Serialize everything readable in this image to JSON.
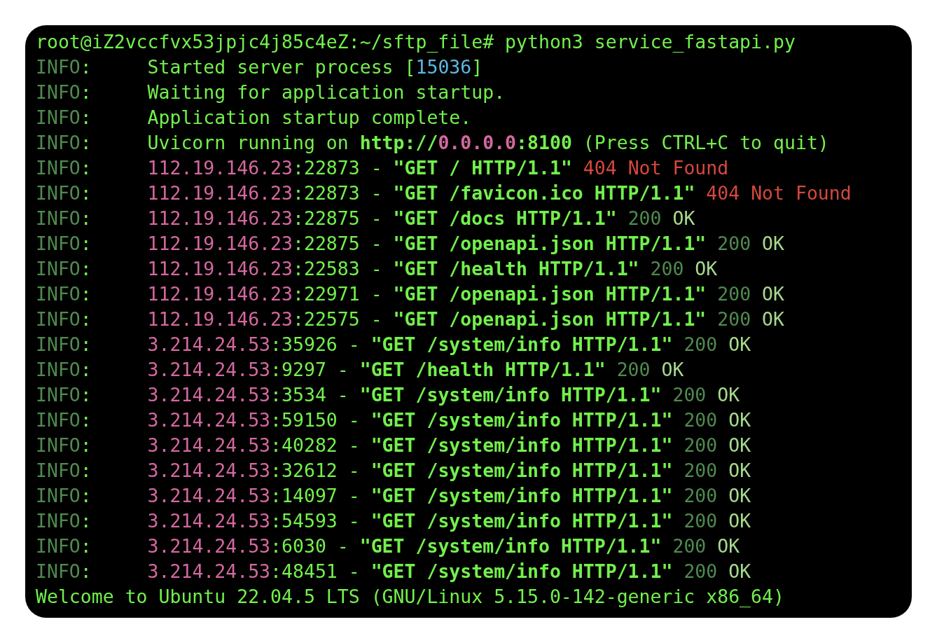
{
  "terminal": {
    "lines": [
      [
        {
          "text": "root@iZ2vccfvx53jpjc4j85c4eZ:~/sftp_file# python3 service_fastapi.py",
          "kind": "plain"
        }
      ],
      [
        {
          "text": "INFO",
          "kind": "dim"
        },
        {
          "text": ":     Started server process [",
          "kind": "plain"
        },
        {
          "text": "15036",
          "kind": "pid"
        },
        {
          "text": "]",
          "kind": "plain"
        }
      ],
      [
        {
          "text": "INFO",
          "kind": "dim"
        },
        {
          "text": ":     Waiting for application startup.",
          "kind": "plain"
        }
      ],
      [
        {
          "text": "INFO",
          "kind": "dim"
        },
        {
          "text": ":     Application startup complete.",
          "kind": "plain"
        }
      ],
      [
        {
          "text": "INFO",
          "kind": "dim"
        },
        {
          "text": ":     Uvicorn running on ",
          "kind": "plain"
        },
        {
          "text": "http://",
          "kind": "bold"
        },
        {
          "text": "0.0.0.0",
          "kind": "host-bold"
        },
        {
          "text": ":8100",
          "kind": "bold"
        },
        {
          "text": " (Press CTRL+C to quit)",
          "kind": "plain"
        }
      ],
      [
        {
          "text": "INFO",
          "kind": "dim"
        },
        {
          "text": ":     ",
          "kind": "plain"
        },
        {
          "text": "112.19.146.23",
          "kind": "host"
        },
        {
          "text": ":22873 - ",
          "kind": "plain"
        },
        {
          "text": "\"GET / HTTP/1.1\"",
          "kind": "bold"
        },
        {
          "text": " 404 Not Found",
          "kind": "error"
        }
      ],
      [
        {
          "text": "INFO",
          "kind": "dim"
        },
        {
          "text": ":     ",
          "kind": "plain"
        },
        {
          "text": "112.19.146.23",
          "kind": "host"
        },
        {
          "text": ":22873 - ",
          "kind": "plain"
        },
        {
          "text": "\"GET /favicon.ico HTTP/1.1\"",
          "kind": "bold"
        },
        {
          "text": " 404 Not Found",
          "kind": "error"
        }
      ],
      [
        {
          "text": "INFO",
          "kind": "dim"
        },
        {
          "text": ":     ",
          "kind": "plain"
        },
        {
          "text": "112.19.146.23",
          "kind": "host"
        },
        {
          "text": ":22875 - ",
          "kind": "plain"
        },
        {
          "text": "\"GET /docs HTTP/1.1\"",
          "kind": "bold"
        },
        {
          "text": " 200",
          "kind": "code"
        },
        {
          "text": " OK",
          "kind": "ok"
        }
      ],
      [
        {
          "text": "INFO",
          "kind": "dim"
        },
        {
          "text": ":     ",
          "kind": "plain"
        },
        {
          "text": "112.19.146.23",
          "kind": "host"
        },
        {
          "text": ":22875 - ",
          "kind": "plain"
        },
        {
          "text": "\"GET /openapi.json HTTP/1.1\"",
          "kind": "bold"
        },
        {
          "text": " 200",
          "kind": "code"
        },
        {
          "text": " OK",
          "kind": "ok"
        }
      ],
      [
        {
          "text": "INFO",
          "kind": "dim"
        },
        {
          "text": ":     ",
          "kind": "plain"
        },
        {
          "text": "112.19.146.23",
          "kind": "host"
        },
        {
          "text": ":22583 - ",
          "kind": "plain"
        },
        {
          "text": "\"GET /health HTTP/1.1\"",
          "kind": "bold"
        },
        {
          "text": " 200",
          "kind": "code"
        },
        {
          "text": " OK",
          "kind": "ok"
        }
      ],
      [
        {
          "text": "INFO",
          "kind": "dim"
        },
        {
          "text": ":     ",
          "kind": "plain"
        },
        {
          "text": "112.19.146.23",
          "kind": "host"
        },
        {
          "text": ":22971 - ",
          "kind": "plain"
        },
        {
          "text": "\"GET /openapi.json HTTP/1.1\"",
          "kind": "bold"
        },
        {
          "text": " 200",
          "kind": "code"
        },
        {
          "text": " OK",
          "kind": "ok"
        }
      ],
      [
        {
          "text": "INFO",
          "kind": "dim"
        },
        {
          "text": ":     ",
          "kind": "plain"
        },
        {
          "text": "112.19.146.23",
          "kind": "host"
        },
        {
          "text": ":22575 - ",
          "kind": "plain"
        },
        {
          "text": "\"GET /openapi.json HTTP/1.1\"",
          "kind": "bold"
        },
        {
          "text": " 200",
          "kind": "code"
        },
        {
          "text": " OK",
          "kind": "ok"
        }
      ],
      [
        {
          "text": "INFO",
          "kind": "dim"
        },
        {
          "text": ":     ",
          "kind": "plain"
        },
        {
          "text": "3.214.24.53",
          "kind": "host"
        },
        {
          "text": ":35926 - ",
          "kind": "plain"
        },
        {
          "text": "\"GET /system/info HTTP/1.1\"",
          "kind": "bold"
        },
        {
          "text": " 200",
          "kind": "code"
        },
        {
          "text": " OK",
          "kind": "ok"
        }
      ],
      [
        {
          "text": "INFO",
          "kind": "dim"
        },
        {
          "text": ":     ",
          "kind": "plain"
        },
        {
          "text": "3.214.24.53",
          "kind": "host"
        },
        {
          "text": ":9297 - ",
          "kind": "plain"
        },
        {
          "text": "\"GET /health HTTP/1.1\"",
          "kind": "bold"
        },
        {
          "text": " 200",
          "kind": "code"
        },
        {
          "text": " OK",
          "kind": "ok"
        }
      ],
      [
        {
          "text": "INFO",
          "kind": "dim"
        },
        {
          "text": ":     ",
          "kind": "plain"
        },
        {
          "text": "3.214.24.53",
          "kind": "host"
        },
        {
          "text": ":3534 - ",
          "kind": "plain"
        },
        {
          "text": "\"GET /system/info HTTP/1.1\"",
          "kind": "bold"
        },
        {
          "text": " 200",
          "kind": "code"
        },
        {
          "text": " OK",
          "kind": "ok"
        }
      ],
      [
        {
          "text": "INFO",
          "kind": "dim"
        },
        {
          "text": ":     ",
          "kind": "plain"
        },
        {
          "text": "3.214.24.53",
          "kind": "host"
        },
        {
          "text": ":59150 - ",
          "kind": "plain"
        },
        {
          "text": "\"GET /system/info HTTP/1.1\"",
          "kind": "bold"
        },
        {
          "text": " 200",
          "kind": "code"
        },
        {
          "text": " OK",
          "kind": "ok"
        }
      ],
      [
        {
          "text": "INFO",
          "kind": "dim"
        },
        {
          "text": ":     ",
          "kind": "plain"
        },
        {
          "text": "3.214.24.53",
          "kind": "host"
        },
        {
          "text": ":40282 - ",
          "kind": "plain"
        },
        {
          "text": "\"GET /system/info HTTP/1.1\"",
          "kind": "bold"
        },
        {
          "text": " 200",
          "kind": "code"
        },
        {
          "text": " OK",
          "kind": "ok"
        }
      ],
      [
        {
          "text": "INFO",
          "kind": "dim"
        },
        {
          "text": ":     ",
          "kind": "plain"
        },
        {
          "text": "3.214.24.53",
          "kind": "host"
        },
        {
          "text": ":32612 - ",
          "kind": "plain"
        },
        {
          "text": "\"GET /system/info HTTP/1.1\"",
          "kind": "bold"
        },
        {
          "text": " 200",
          "kind": "code"
        },
        {
          "text": " OK",
          "kind": "ok"
        }
      ],
      [
        {
          "text": "INFO",
          "kind": "dim"
        },
        {
          "text": ":     ",
          "kind": "plain"
        },
        {
          "text": "3.214.24.53",
          "kind": "host"
        },
        {
          "text": ":14097 - ",
          "kind": "plain"
        },
        {
          "text": "\"GET /system/info HTTP/1.1\"",
          "kind": "bold"
        },
        {
          "text": " 200",
          "kind": "code"
        },
        {
          "text": " OK",
          "kind": "ok"
        }
      ],
      [
        {
          "text": "INFO",
          "kind": "dim"
        },
        {
          "text": ":     ",
          "kind": "plain"
        },
        {
          "text": "3.214.24.53",
          "kind": "host"
        },
        {
          "text": ":54593 - ",
          "kind": "plain"
        },
        {
          "text": "\"GET /system/info HTTP/1.1\"",
          "kind": "bold"
        },
        {
          "text": " 200",
          "kind": "code"
        },
        {
          "text": " OK",
          "kind": "ok"
        }
      ],
      [
        {
          "text": "INFO",
          "kind": "dim"
        },
        {
          "text": ":     ",
          "kind": "plain"
        },
        {
          "text": "3.214.24.53",
          "kind": "host"
        },
        {
          "text": ":6030 - ",
          "kind": "plain"
        },
        {
          "text": "\"GET /system/info HTTP/1.1\"",
          "kind": "bold"
        },
        {
          "text": " 200",
          "kind": "code"
        },
        {
          "text": " OK",
          "kind": "ok"
        }
      ],
      [
        {
          "text": "INFO",
          "kind": "dim"
        },
        {
          "text": ":     ",
          "kind": "plain"
        },
        {
          "text": "3.214.24.53",
          "kind": "host"
        },
        {
          "text": ":48451 - ",
          "kind": "plain"
        },
        {
          "text": "\"GET /system/info HTTP/1.1\"",
          "kind": "bold"
        },
        {
          "text": " 200",
          "kind": "code"
        },
        {
          "text": " OK",
          "kind": "ok"
        }
      ],
      [
        {
          "text": "Welcome to Ubuntu 22.04.5 LTS (GNU/Linux 5.15.0-142-generic x86_64)",
          "kind": "plain"
        }
      ]
    ]
  }
}
